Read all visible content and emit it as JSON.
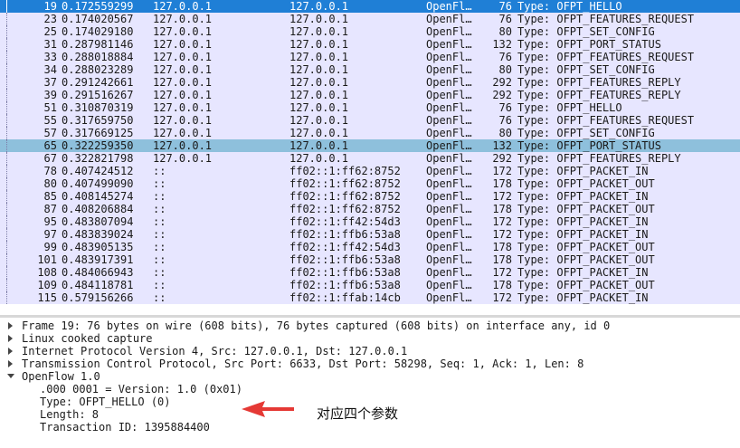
{
  "packets": [
    {
      "no": "19",
      "time": "0.172559299",
      "src": "127.0.0.1",
      "dst": "127.0.0.1",
      "proto": "OpenFl…",
      "len": "76",
      "info": "Type: OFPT_HELLO",
      "state": "selected"
    },
    {
      "no": "23",
      "time": "0.174020567",
      "src": "127.0.0.1",
      "dst": "127.0.0.1",
      "proto": "OpenFl…",
      "len": "76",
      "info": "Type: OFPT_FEATURES_REQUEST"
    },
    {
      "no": "25",
      "time": "0.174029180",
      "src": "127.0.0.1",
      "dst": "127.0.0.1",
      "proto": "OpenFl…",
      "len": "80",
      "info": "Type: OFPT_SET_CONFIG"
    },
    {
      "no": "31",
      "time": "0.287981146",
      "src": "127.0.0.1",
      "dst": "127.0.0.1",
      "proto": "OpenFl…",
      "len": "132",
      "info": "Type: OFPT_PORT_STATUS"
    },
    {
      "no": "33",
      "time": "0.288018884",
      "src": "127.0.0.1",
      "dst": "127.0.0.1",
      "proto": "OpenFl…",
      "len": "76",
      "info": "Type: OFPT_FEATURES_REQUEST"
    },
    {
      "no": "34",
      "time": "0.288023289",
      "src": "127.0.0.1",
      "dst": "127.0.0.1",
      "proto": "OpenFl…",
      "len": "80",
      "info": "Type: OFPT_SET_CONFIG"
    },
    {
      "no": "37",
      "time": "0.291242661",
      "src": "127.0.0.1",
      "dst": "127.0.0.1",
      "proto": "OpenFl…",
      "len": "292",
      "info": "Type: OFPT_FEATURES_REPLY"
    },
    {
      "no": "39",
      "time": "0.291516267",
      "src": "127.0.0.1",
      "dst": "127.0.0.1",
      "proto": "OpenFl…",
      "len": "292",
      "info": "Type: OFPT_FEATURES_REPLY"
    },
    {
      "no": "51",
      "time": "0.310870319",
      "src": "127.0.0.1",
      "dst": "127.0.0.1",
      "proto": "OpenFl…",
      "len": "76",
      "info": "Type: OFPT_HELLO"
    },
    {
      "no": "55",
      "time": "0.317659750",
      "src": "127.0.0.1",
      "dst": "127.0.0.1",
      "proto": "OpenFl…",
      "len": "76",
      "info": "Type: OFPT_FEATURES_REQUEST"
    },
    {
      "no": "57",
      "time": "0.317669125",
      "src": "127.0.0.1",
      "dst": "127.0.0.1",
      "proto": "OpenFl…",
      "len": "80",
      "info": "Type: OFPT_SET_CONFIG"
    },
    {
      "no": "65",
      "time": "0.322259350",
      "src": "127.0.0.1",
      "dst": "127.0.0.1",
      "proto": "OpenFl…",
      "len": "132",
      "info": "Type: OFPT_PORT_STATUS",
      "state": "marked"
    },
    {
      "no": "67",
      "time": "0.322821798",
      "src": "127.0.0.1",
      "dst": "127.0.0.1",
      "proto": "OpenFl…",
      "len": "292",
      "info": "Type: OFPT_FEATURES_REPLY"
    },
    {
      "no": "78",
      "time": "0.407424512",
      "src": "::",
      "dst": "ff02::1:ff62:8752",
      "proto": "OpenFl…",
      "len": "172",
      "info": "Type: OFPT_PACKET_IN"
    },
    {
      "no": "80",
      "time": "0.407499090",
      "src": "::",
      "dst": "ff02::1:ff62:8752",
      "proto": "OpenFl…",
      "len": "178",
      "info": "Type: OFPT_PACKET_OUT"
    },
    {
      "no": "85",
      "time": "0.408145274",
      "src": "::",
      "dst": "ff02::1:ff62:8752",
      "proto": "OpenFl…",
      "len": "172",
      "info": "Type: OFPT_PACKET_IN"
    },
    {
      "no": "87",
      "time": "0.408206884",
      "src": "::",
      "dst": "ff02::1:ff62:8752",
      "proto": "OpenFl…",
      "len": "178",
      "info": "Type: OFPT_PACKET_OUT"
    },
    {
      "no": "95",
      "time": "0.483807094",
      "src": "::",
      "dst": "ff02::1:ff42:54d3",
      "proto": "OpenFl…",
      "len": "172",
      "info": "Type: OFPT_PACKET_IN"
    },
    {
      "no": "97",
      "time": "0.483839024",
      "src": "::",
      "dst": "ff02::1:ffb6:53a8",
      "proto": "OpenFl…",
      "len": "172",
      "info": "Type: OFPT_PACKET_IN"
    },
    {
      "no": "99",
      "time": "0.483905135",
      "src": "::",
      "dst": "ff02::1:ff42:54d3",
      "proto": "OpenFl…",
      "len": "178",
      "info": "Type: OFPT_PACKET_OUT"
    },
    {
      "no": "101",
      "time": "0.483917391",
      "src": "::",
      "dst": "ff02::1:ffb6:53a8",
      "proto": "OpenFl…",
      "len": "178",
      "info": "Type: OFPT_PACKET_OUT"
    },
    {
      "no": "108",
      "time": "0.484066943",
      "src": "::",
      "dst": "ff02::1:ffb6:53a8",
      "proto": "OpenFl…",
      "len": "172",
      "info": "Type: OFPT_PACKET_IN"
    },
    {
      "no": "109",
      "time": "0.484118781",
      "src": "::",
      "dst": "ff02::1:ffb6:53a8",
      "proto": "OpenFl…",
      "len": "178",
      "info": "Type: OFPT_PACKET_OUT"
    },
    {
      "no": "115",
      "time": "0.579156266",
      "src": "::",
      "dst": "ff02::1:ffab:14cb",
      "proto": "OpenFl…",
      "len": "172",
      "info": "Type: OFPT_PACKET_IN"
    }
  ],
  "details": [
    {
      "text": "Frame 19: 76 bytes on wire (608 bits), 76 bytes captured (608 bits) on interface any, id 0",
      "expanded": false
    },
    {
      "text": "Linux cooked capture",
      "expanded": false
    },
    {
      "text": "Internet Protocol Version 4, Src: 127.0.0.1, Dst: 127.0.0.1",
      "expanded": false
    },
    {
      "text": "Transmission Control Protocol, Src Port: 6633, Dst Port: 58298, Seq: 1, Ack: 1, Len: 8",
      "expanded": false
    },
    {
      "text": "OpenFlow 1.0",
      "expanded": true
    },
    {
      "text": ".000 0001 = Version: 1.0 (0x01)",
      "child": true
    },
    {
      "text": "Type: OFPT_HELLO (0)",
      "child": true
    },
    {
      "text": "Length: 8",
      "child": true
    },
    {
      "text": "Transaction ID: 1395884400",
      "child": true
    }
  ],
  "annotation": {
    "text": "对应四个参数",
    "arrow_color": "#e53935"
  },
  "colors": {
    "list_bg": "#e7e6ff",
    "selected": "#1f7fd6",
    "marked": "#8ec0dc"
  }
}
